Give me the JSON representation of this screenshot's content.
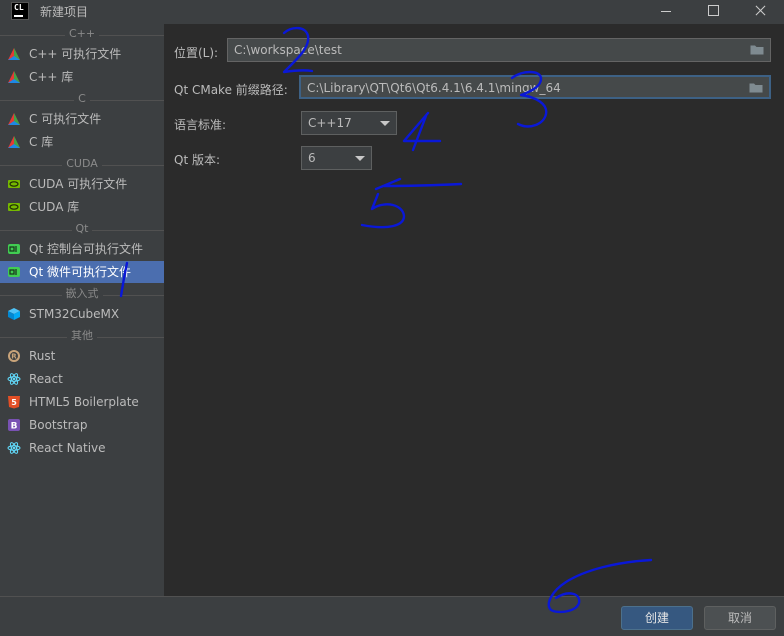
{
  "window": {
    "title": "新建项目",
    "logo_text": "CL"
  },
  "sidebar": {
    "groups": [
      {
        "label": "C++",
        "items": [
          {
            "label": "C++ 可执行文件",
            "icon": "cmake-triangle-icon"
          },
          {
            "label": "C++ 库",
            "icon": "cmake-triangle-icon"
          }
        ]
      },
      {
        "label": "C",
        "items": [
          {
            "label": "C 可执行文件",
            "icon": "cmake-triangle-icon"
          },
          {
            "label": "C 库",
            "icon": "cmake-triangle-icon"
          }
        ]
      },
      {
        "label": "CUDA",
        "items": [
          {
            "label": "CUDA 可执行文件",
            "icon": "nvidia-icon"
          },
          {
            "label": "CUDA 库",
            "icon": "nvidia-icon"
          }
        ]
      },
      {
        "label": "Qt",
        "items": [
          {
            "label": "Qt 控制台可执行文件",
            "icon": "qt-icon"
          },
          {
            "label": "Qt 微件可执行文件",
            "icon": "qt-icon",
            "selected": true
          }
        ]
      },
      {
        "label": "嵌入式",
        "items": [
          {
            "label": "STM32CubeMX",
            "icon": "stm32-cube-icon"
          }
        ]
      },
      {
        "label": "其他",
        "items": [
          {
            "label": "Rust",
            "icon": "rust-icon"
          },
          {
            "label": "React",
            "icon": "react-icon"
          },
          {
            "label": "HTML5 Boilerplate",
            "icon": "html5-icon"
          },
          {
            "label": "Bootstrap",
            "icon": "bootstrap-icon"
          },
          {
            "label": "React Native",
            "icon": "react-icon"
          }
        ]
      }
    ]
  },
  "form": {
    "location_label": "位置(L):",
    "location_value": "C:\\workspace\\test",
    "qt_cmake_label": "Qt CMake 前缀路径:",
    "qt_cmake_value": "C:\\Library\\QT\\Qt6\\Qt6.4.1\\6.4.1\\mingw_64",
    "language_label": "语言标准:",
    "language_value": "C++17",
    "qt_version_label": "Qt 版本:",
    "qt_version_value": "6"
  },
  "footer": {
    "create_label": "创建",
    "cancel_label": "取消"
  },
  "colors": {
    "accent": "#4b6eaf",
    "primary_button": "#365880",
    "annotation_ink": "#0a18d8"
  },
  "annotations": [
    "1",
    "2",
    "3",
    "4",
    "5",
    "6"
  ]
}
